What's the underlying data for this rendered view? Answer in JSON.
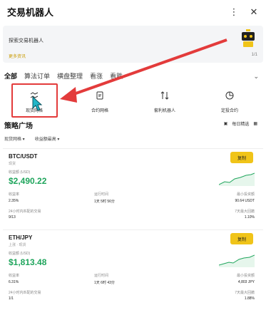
{
  "header": {
    "title": "交易机器人",
    "more_icon": "more-vertical-icon",
    "close_icon": "close-icon"
  },
  "banner": {
    "title": "探索交易机器人",
    "link": "更多资讯",
    "pager": "1/1"
  },
  "tabs": [
    {
      "label": "全部",
      "active": true
    },
    {
      "label": "算法订单",
      "active": false
    },
    {
      "label": "横盘整理",
      "active": false
    },
    {
      "label": "看涨",
      "active": false
    },
    {
      "label": "看跌",
      "active": false
    }
  ],
  "categories": [
    {
      "label": "现货网格",
      "icon": "grid-chart-icon"
    },
    {
      "label": "合约网格",
      "icon": "document-icon"
    },
    {
      "label": "套利机器人",
      "icon": "arbitrage-icon"
    },
    {
      "label": "定投合约",
      "icon": "pie-chart-icon"
    }
  ],
  "strategy": {
    "title": "策略广场",
    "filter_label": "每日精选",
    "filter_icon": "calendar-icon",
    "grid_icon": "layout-icon"
  },
  "filters": [
    {
      "label": "现货网格"
    },
    {
      "label": "收益额最高"
    }
  ],
  "cards": [
    {
      "pair": "BTC/USDT",
      "sub": "现货",
      "button": "复制",
      "income_label": "收益额 (USD)",
      "income_value": "$2,490.22",
      "rows": [
        {
          "a": "收益率",
          "b": "运行时间",
          "c": "最小投资额"
        },
        {
          "a": "2.35%",
          "b": "1天 5时 56分",
          "c": "90.64 USDT"
        },
        {
          "a": "24小时内匹配的交易",
          "b": "",
          "c": "7天最大回撤"
        },
        {
          "a": "9/13",
          "b": "",
          "c": "1.10%"
        }
      ]
    },
    {
      "pair": "ETH/JPY",
      "sub": "上涨 · 现货",
      "button": "复制",
      "income_label": "收益额 (USD)",
      "income_value": "$1,813.48",
      "rows": [
        {
          "a": "收益率",
          "b": "运行时间",
          "c": "最小投资额"
        },
        {
          "a": "6.31%",
          "b": "1天 6时 43分",
          "c": "4,803 JPY"
        },
        {
          "a": "24小时内匹配的交易",
          "b": "",
          "c": "7天最大回撤"
        },
        {
          "a": "1/1",
          "b": "",
          "c": "1.88%"
        }
      ]
    }
  ],
  "colors": {
    "accent": "#f0c419",
    "positive": "#1fa55c",
    "annotation": "#e33b3b"
  }
}
